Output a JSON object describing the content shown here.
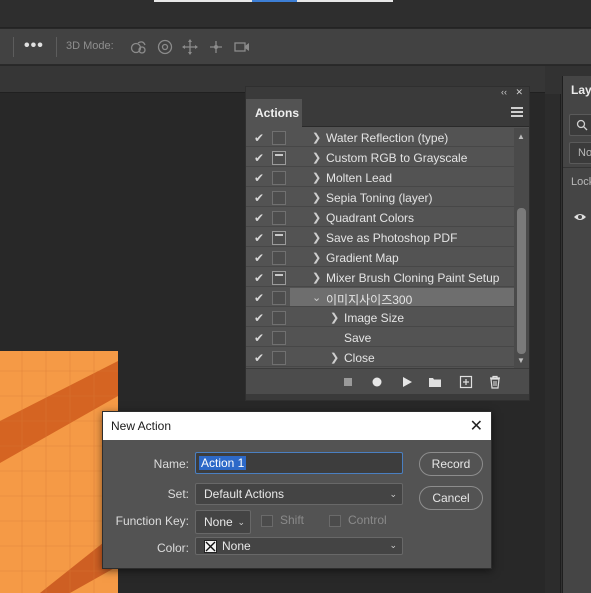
{
  "colors": {
    "accent": "#2d69c8",
    "canvas": "#f59a46",
    "panel": "#535353",
    "dialog_title_bg": "#ffffff"
  },
  "options_bar": {
    "more_label": "•••",
    "mode_label": "3D Mode:",
    "tools": [
      "orbit-3d-icon",
      "roll-3d-icon",
      "pan-3d-icon",
      "slide-3d-icon",
      "camera-3d-icon"
    ]
  },
  "actions_panel": {
    "tab_label": "Actions",
    "collapse_glyph": "‹‹",
    "close_glyph": "✕",
    "rows": [
      {
        "label": "Water Reflection (type)",
        "checked": true,
        "dialog": false,
        "expander": "❯",
        "indent": 0
      },
      {
        "label": "Custom RGB to Grayscale",
        "checked": true,
        "dialog": true,
        "expander": "❯",
        "indent": 0
      },
      {
        "label": "Molten Lead",
        "checked": true,
        "dialog": false,
        "expander": "❯",
        "indent": 0
      },
      {
        "label": "Sepia Toning (layer)",
        "checked": true,
        "dialog": false,
        "expander": "❯",
        "indent": 0
      },
      {
        "label": "Quadrant Colors",
        "checked": true,
        "dialog": false,
        "expander": "❯",
        "indent": 0
      },
      {
        "label": "Save as Photoshop PDF",
        "checked": true,
        "dialog": true,
        "expander": "❯",
        "indent": 0
      },
      {
        "label": "Gradient Map",
        "checked": true,
        "dialog": false,
        "expander": "❯",
        "indent": 0
      },
      {
        "label": "Mixer Brush Cloning Paint Setup",
        "checked": true,
        "dialog": true,
        "expander": "❯",
        "indent": 0
      },
      {
        "label": "이미지사이즈300",
        "checked": true,
        "dialog": false,
        "expander": "⌄",
        "indent": 0,
        "selected": true
      },
      {
        "label": "Image Size",
        "checked": true,
        "dialog": false,
        "expander": "❯",
        "indent": 1
      },
      {
        "label": "Save",
        "checked": true,
        "dialog": false,
        "expander": "",
        "indent": 1
      },
      {
        "label": "Close",
        "checked": true,
        "dialog": false,
        "expander": "❯",
        "indent": 1
      }
    ],
    "footer": [
      "stop-icon",
      "record-icon",
      "play-icon",
      "folder-icon",
      "new-action-icon",
      "trash-icon"
    ]
  },
  "layers_panel": {
    "tab_label": "Lay",
    "kind_label": "No",
    "lock_label": "Lock"
  },
  "dialog": {
    "title": "New Action",
    "close_glyph": "✕",
    "name_label": "Name:",
    "name_value": "Action 1",
    "set_label": "Set:",
    "set_value": "Default Actions",
    "function_key_label": "Function Key:",
    "function_key_value": "None",
    "shift_label": "Shift",
    "control_label": "Control",
    "color_label": "Color:",
    "color_value": "None",
    "record_button": "Record",
    "cancel_button": "Cancel"
  }
}
